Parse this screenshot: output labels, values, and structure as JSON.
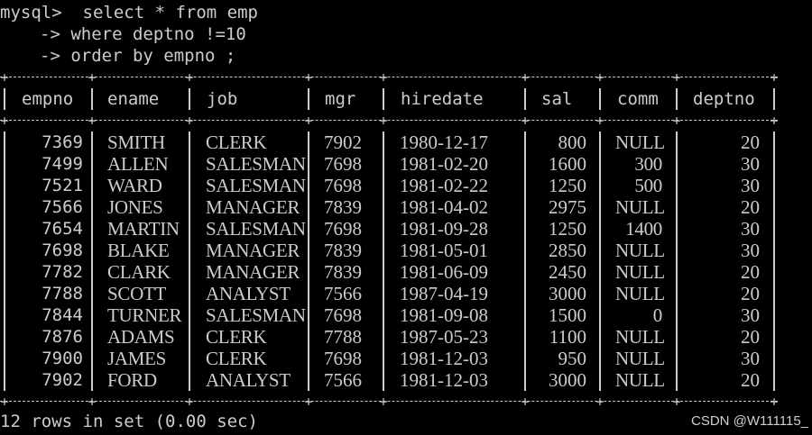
{
  "window": {
    "colors": {
      "background": "#000000",
      "text": "#cccccc"
    }
  },
  "query": {
    "lines": [
      "mysql>  select * from emp",
      "-> where deptno !=10",
      "-> order by empno ;"
    ]
  },
  "table": {
    "columns": [
      "empno",
      "ename",
      "job",
      "mgr",
      "hiredate",
      "sal",
      "comm",
      "deptno"
    ],
    "rows": [
      [
        "7369",
        "SMITH",
        "CLERK",
        "7902",
        "1980-12-17",
        "800",
        "NULL",
        "20"
      ],
      [
        "7499",
        "ALLEN",
        "SALESMAN",
        "7698",
        "1981-02-20",
        "1600",
        "300",
        "30"
      ],
      [
        "7521",
        "WARD",
        "SALESMAN",
        "7698",
        "1981-02-22",
        "1250",
        "500",
        "30"
      ],
      [
        "7566",
        "JONES",
        "MANAGER",
        "7839",
        "1981-04-02",
        "2975",
        "NULL",
        "20"
      ],
      [
        "7654",
        "MARTIN",
        "SALESMAN",
        "7698",
        "1981-09-28",
        "1250",
        "1400",
        "30"
      ],
      [
        "7698",
        "BLAKE",
        "MANAGER",
        "7839",
        "1981-05-01",
        "2850",
        "NULL",
        "30"
      ],
      [
        "7782",
        "CLARK",
        "MANAGER",
        "7839",
        "1981-06-09",
        "2450",
        "NULL",
        "20"
      ],
      [
        "7788",
        "SCOTT",
        "ANALYST",
        "7566",
        "1987-04-19",
        "3000",
        "NULL",
        "20"
      ],
      [
        "7844",
        "TURNER",
        "SALESMAN",
        "7698",
        "1981-09-08",
        "1500",
        "0",
        "30"
      ],
      [
        "7876",
        "ADAMS",
        "CLERK",
        "7788",
        "1987-05-23",
        "1100",
        "NULL",
        "20"
      ],
      [
        "7900",
        "JAMES",
        "CLERK",
        "7698",
        "1981-12-03",
        "950",
        "NULL",
        "30"
      ],
      [
        "7902",
        "FORD",
        "ANALYST",
        "7566",
        "1981-12-03",
        "3000",
        "NULL",
        "20"
      ]
    ]
  },
  "status": "12 rows in set (0.00 sec)",
  "watermark": "CSDN @W111115_"
}
